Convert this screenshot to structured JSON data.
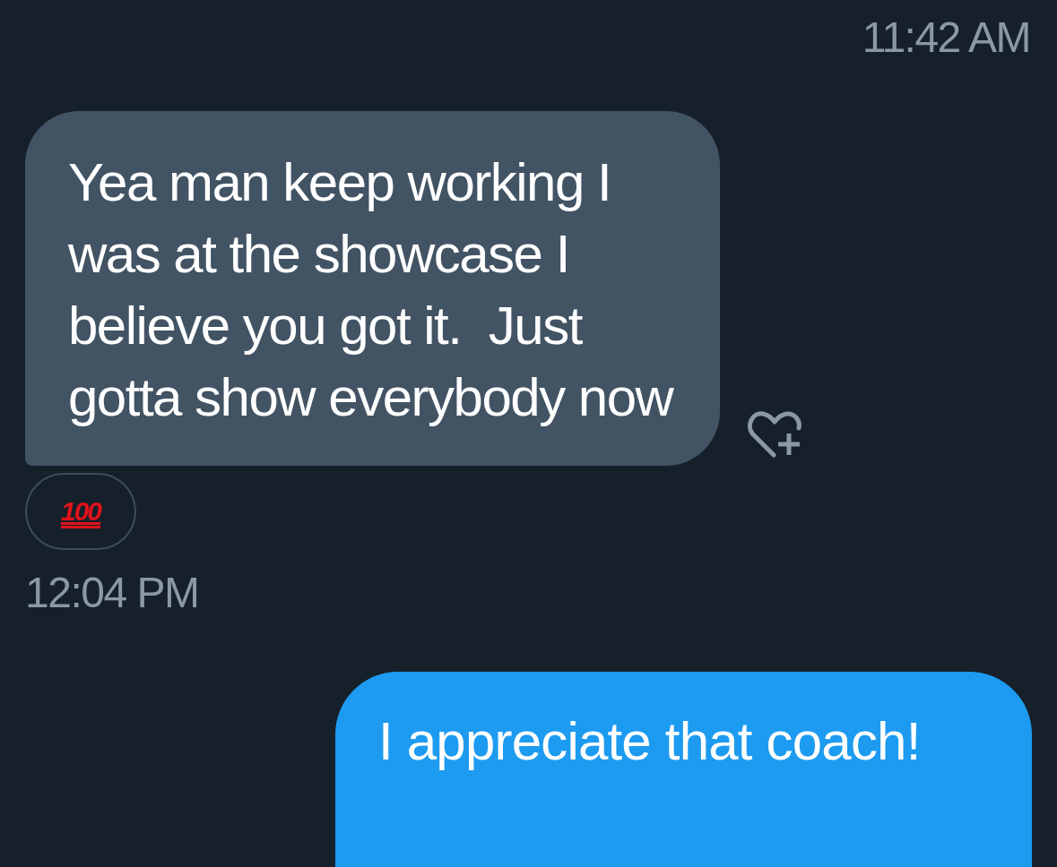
{
  "messages": [
    {
      "kind": "timestamp",
      "text": "11:42 AM"
    },
    {
      "kind": "received",
      "text": "Yea man keep working I was at the showcase I believe you got it.  Just gotta show everybody now",
      "reaction": "100"
    },
    {
      "kind": "timestamp",
      "text": "12:04 PM"
    },
    {
      "kind": "sent",
      "text": "I appreciate that coach!"
    }
  ]
}
